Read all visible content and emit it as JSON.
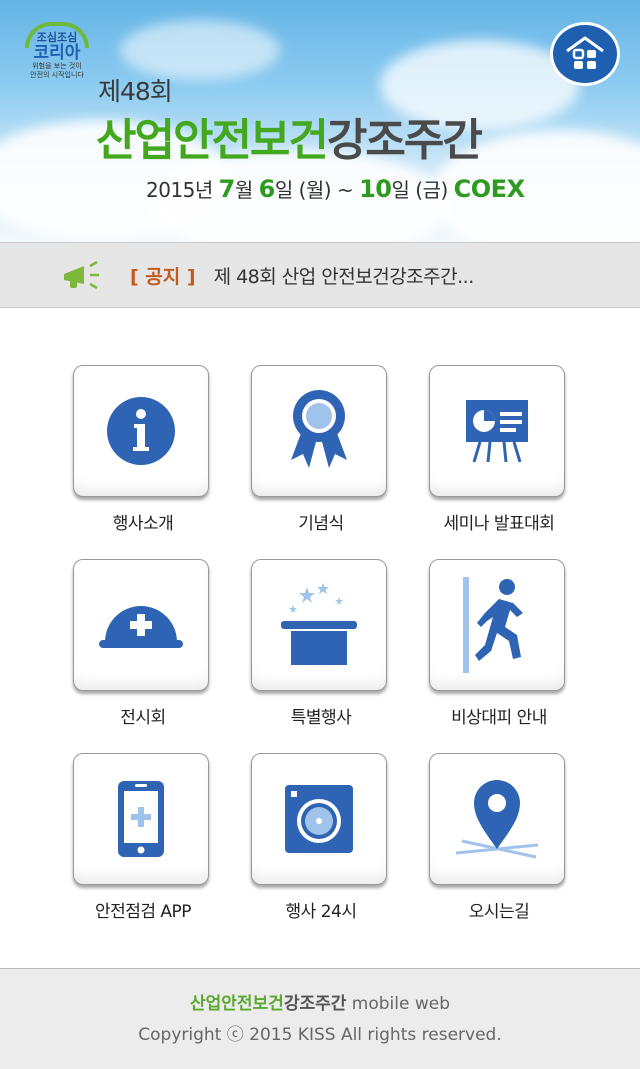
{
  "header": {
    "logo": {
      "top": "조심조심",
      "main": "코리아",
      "sub1": "위험을 보는 것이",
      "sub2": "안전의 시작입니다"
    },
    "edition": "제48회",
    "title_green": "산업안전보건",
    "title_gray": "강조주간",
    "dates": {
      "year": "2015년",
      "month": "7",
      "month_unit": "월",
      "day_start": "6",
      "day_unit": "일",
      "day_start_dow": "(월)",
      "tilde": "~",
      "day_end": "10",
      "day_end_unit": "일",
      "day_end_dow": "(금)",
      "venue": "COEX"
    },
    "home_icon": "home-icon"
  },
  "notice": {
    "icon": "megaphone-icon",
    "tag": "[ 공지 ]",
    "text": "제 48회 산업 안전보건강조주간..."
  },
  "menu": [
    {
      "label": "행사소개",
      "icon": "info-icon"
    },
    {
      "label": "기념식",
      "icon": "award-ribbon-icon"
    },
    {
      "label": "세미나 발표대회",
      "icon": "presentation-board-icon"
    },
    {
      "label": "전시회",
      "icon": "hard-hat-icon"
    },
    {
      "label": "특별행사",
      "icon": "magic-hat-icon"
    },
    {
      "label": "비상대피 안내",
      "icon": "emergency-exit-icon"
    },
    {
      "label": "안전점검 APP",
      "icon": "smartphone-icon"
    },
    {
      "label": "행사 24시",
      "icon": "camera-icon"
    },
    {
      "label": "오시는길",
      "icon": "location-pin-icon"
    }
  ],
  "footer": {
    "title_green": "산업안전보건",
    "title_gray": "강조주간",
    "suffix": "mobile web",
    "copyright": "Copyright ⓒ 2015 KISS All rights reserved."
  },
  "colors": {
    "brand_blue": "#2f64b4",
    "brand_green": "#43a81e",
    "accent_orange": "#c55a1e"
  }
}
